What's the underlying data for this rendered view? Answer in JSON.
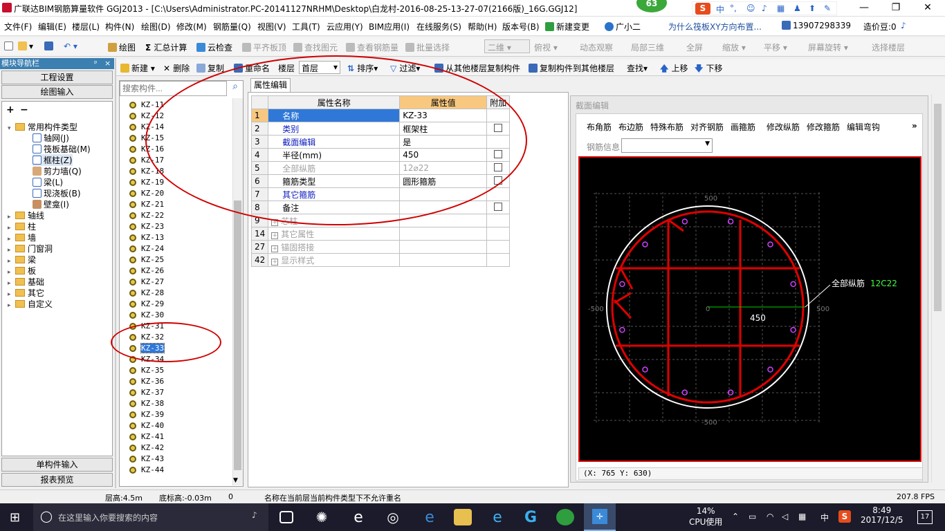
{
  "title": "广联达BIM钢筋算量软件 GGJ2013 - [C:\\Users\\Administrator.PC-20141127NRHM\\Desktop\\白龙村-2016-08-25-13-27-07(2166版)_16G.GGJ12]",
  "badge": "63",
  "window_controls": {
    "minimize": "—",
    "maximize": "❐",
    "close": "✕"
  },
  "ime": {
    "label": "中",
    "sym": "°,"
  },
  "menu": [
    "文件(F)",
    "编辑(E)",
    "楼层(L)",
    "构件(N)",
    "绘图(D)",
    "修改(M)",
    "钢筋量(Q)",
    "视图(V)",
    "工具(T)",
    "云应用(Y)",
    "BIM应用(I)",
    "在线服务(S)",
    "帮助(H)",
    "版本号(B)",
    "新建变更",
    "广小二",
    "为什么筏板XY方向布置...",
    "13907298339",
    "造价豆:0"
  ],
  "toolbar1": [
    "绘图",
    "汇总计算",
    "云检查",
    "平齐板顶",
    "查找图元",
    "查看钢筋量",
    "批量选择",
    "二维",
    "俯视",
    "动态观察",
    "局部三维",
    "全屏",
    "缩放",
    "平移",
    "屏幕旋转",
    "选择楼层"
  ],
  "nav": {
    "header": "模块导航栏",
    "pin": "ᵖ",
    "close": "×",
    "project_settings": "工程设置",
    "drawing_input": "绘图输入",
    "single_input": "单构件输入",
    "report": "报表预览",
    "expand": "+",
    "collapse": "−",
    "common_types": "常用构件类型",
    "common_items": [
      "轴网(J)",
      "筏板基础(M)",
      "框柱(Z)",
      "剪力墙(Q)",
      "梁(L)",
      "现浇板(B)",
      "壁龛(I)"
    ],
    "folders": [
      "轴线",
      "柱",
      "墙",
      "门窗洞",
      "梁",
      "板",
      "基础",
      "其它",
      "自定义"
    ]
  },
  "toolbar2": [
    "新建",
    "删除",
    "复制",
    "重命名",
    "楼层",
    "首层",
    "排序",
    "过滤",
    "从其他楼层复制构件",
    "复制构件到其他楼层",
    "查找",
    "上移",
    "下移"
  ],
  "search_placeholder": "搜索构件...",
  "components": [
    "KZ-11",
    "KZ-12",
    "KZ-14",
    "KZ-15",
    "KZ-16",
    "KZ-17",
    "KZ-18",
    "KZ-19",
    "KZ-20",
    "KZ-21",
    "KZ-22",
    "KZ-23",
    "KZ-13",
    "KZ-24",
    "KZ-25",
    "KZ-26",
    "KZ-27",
    "KZ-28",
    "KZ-29",
    "KZ-30",
    "KZ-31",
    "KZ-32",
    "KZ-33",
    "KZ-34",
    "KZ-35",
    "KZ-36",
    "KZ-37",
    "KZ-38",
    "KZ-39",
    "KZ-40",
    "KZ-41",
    "KZ-42",
    "KZ-43",
    "KZ-44"
  ],
  "selected_component": "KZ-33",
  "prop": {
    "tab": "属性编辑",
    "col_name": "属性名称",
    "col_value": "属性值",
    "col_add": "附加",
    "rows": [
      {
        "n": "1",
        "name": "名称",
        "value": "KZ-33"
      },
      {
        "n": "2",
        "name": "类别",
        "value": "框架柱"
      },
      {
        "n": "3",
        "name": "截面编辑",
        "value": "是"
      },
      {
        "n": "4",
        "name": "半径(mm)",
        "value": "450"
      },
      {
        "n": "5",
        "name": "全部纵筋",
        "value": "12⌀22"
      },
      {
        "n": "6",
        "name": "箍筋类型",
        "value": "圆形箍筋"
      },
      {
        "n": "7",
        "name": "其它箍筋",
        "value": ""
      },
      {
        "n": "8",
        "name": "备注",
        "value": ""
      },
      {
        "n": "9",
        "name": "芯柱",
        "value": ""
      },
      {
        "n": "14",
        "name": "其它属性",
        "value": ""
      },
      {
        "n": "27",
        "name": "锚固搭接",
        "value": ""
      },
      {
        "n": "42",
        "name": "显示样式",
        "value": ""
      }
    ]
  },
  "section": {
    "title": "截面编辑",
    "tools": [
      "布角筋",
      "布边筋",
      "特殊布筋",
      "对齐钢筋",
      "画箍筋",
      "修改纵筋",
      "修改箍筋",
      "编辑弯钩"
    ],
    "rebar_info": "钢筋信息",
    "label": "全部纵筋",
    "label_value": "12C22",
    "dim_450": "450",
    "ticks": {
      "top": "500",
      "bottom": "-500",
      "left": "-500",
      "right": "500",
      "center": "0"
    },
    "coords": "(X: 765 Y: 630)"
  },
  "status": {
    "floor_height": "层高:4.5m",
    "bottom_height": "底标高:-0.03m",
    "zero": "0",
    "message": "名称在当前层当前构件类型下不允许重名",
    "fps": "207.8 FPS"
  },
  "taskbar": {
    "search": "在这里输入你要搜索的内容",
    "cpu_pct": "14%",
    "cpu_label": "CPU使用",
    "time": "8:49",
    "date": "2017/12/5",
    "ime": "中",
    "notify": "17"
  }
}
